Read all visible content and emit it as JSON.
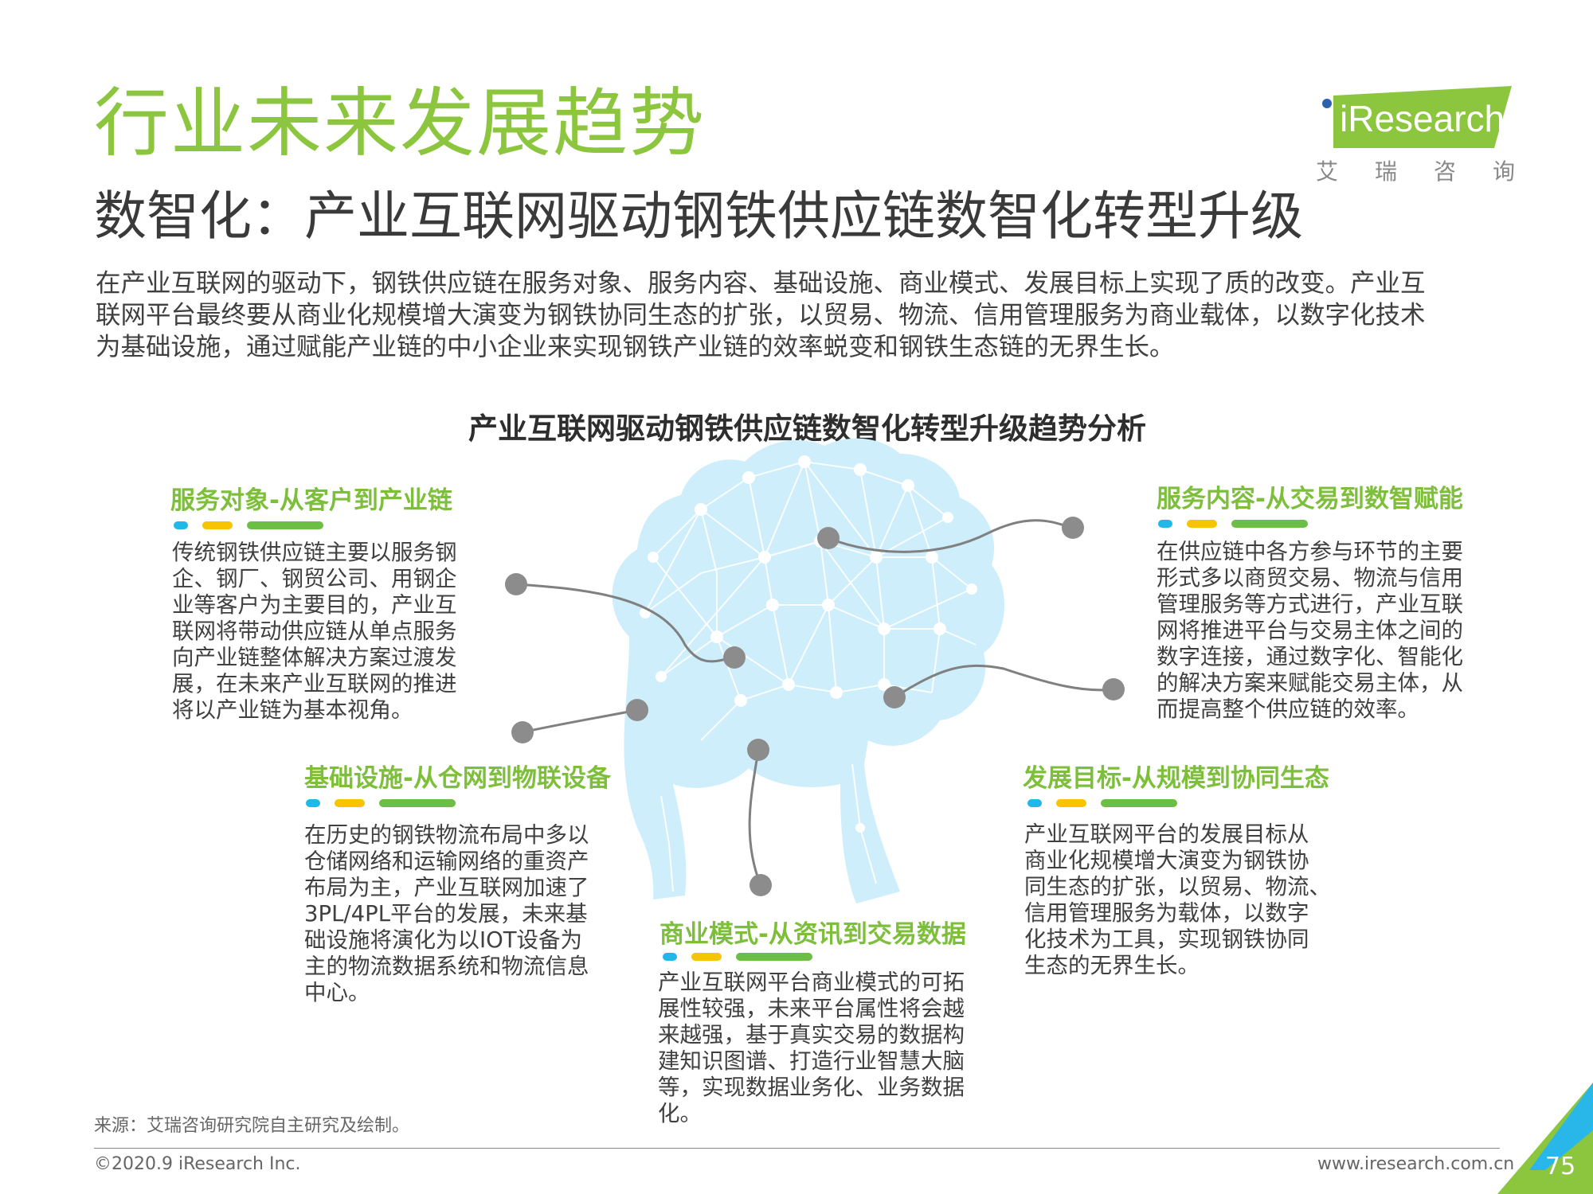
{
  "header": {
    "title": "行业未来发展趋势",
    "subtitle": "数智化：产业互联网驱动钢铁供应链数智化转型升级",
    "intro_lines": [
      "在产业互联网的驱动下，钢铁供应链在服务对象、服务内容、基础设施、商业模式、发展目标上实现了质的改变。产业互",
      "联网平台最终要从商业化规模增大演变为钢铁协同生态的扩张，以贸易、物流、信用管理服务为商业载体，以数字化技术",
      "为基础设施，通过赋能产业链的中小企业来实现钢铁产业链的效率蜕变和钢铁生态链的无界生长。"
    ]
  },
  "logo": {
    "brand": "iResearch",
    "cn": [
      "艾",
      "瑞",
      "咨",
      "询"
    ],
    "colors": {
      "green": "#8cc63f",
      "blue": "#2a62b0"
    }
  },
  "chart": {
    "title": "产业互联网驱动钢铁供应链数智化转型升级趋势分析"
  },
  "sections": {
    "service_object": {
      "heading": "服务对象-从客户到产业链",
      "lines": [
        "传统钢铁供应链主要以服务钢",
        "企、钢厂、钢贸公司、用钢企",
        "业等客户为主要目的，产业互",
        "联网将带动供应链从单点服务",
        "向产业链整体解决方案过渡发",
        "展，在未来产业互联网的推进",
        "将以产业链为基本视角。"
      ]
    },
    "service_content": {
      "heading": "服务内容-从交易到数智赋能",
      "lines": [
        "在供应链中各方参与环节的主要",
        "形式多以商贸交易、物流与信用",
        "管理服务等方式进行，产业互联",
        "网将推进平台与交易主体之间的",
        "数字连接，通过数字化、智能化",
        "的解决方案来赋能交易主体，从",
        "而提高整个供应链的效率。"
      ]
    },
    "infrastructure": {
      "heading": "基础设施-从仓网到物联设备",
      "lines": [
        "在历史的钢铁物流布局中多以",
        "仓储网络和运输网络的重资产",
        "布局为主，产业互联网加速了",
        "3PL/4PL平台的发展，未来基",
        "础设施将演化为以IOT设备为",
        "主的物流数据系统和物流信息",
        "中心。"
      ]
    },
    "development_goal": {
      "heading": "发展目标-从规模到协同生态",
      "lines": [
        "产业互联网平台的发展目标从",
        "商业化规模增大演变为钢铁协",
        "同生态的扩张，以贸易、物流、",
        "信用管理服务为载体，以数字",
        "化技术为工具，实现钢铁协同",
        "生态的无界生长。"
      ]
    },
    "business_model": {
      "heading": "商业模式-从资讯到交易数据",
      "lines": [
        "产业互联网平台商业模式的可拓",
        "展性较强，未来平台属性将会越",
        "来越强，基于真实交易的数据构",
        "建知识图谱、打造行业智慧大脑",
        "等，实现数据业务化、业务数据",
        "化。"
      ]
    }
  },
  "colors": {
    "title_green": "#8cc63f",
    "heading_green": "#7dbf3a",
    "dot_cyan": "#1fb8e8",
    "dot_yellow": "#f6c400",
    "dot_green": "#6cbe45",
    "brain_blue": "#cdeefa"
  },
  "footer": {
    "source": "来源：艾瑞咨询研究院自主研究及绘制。",
    "copyright": "©2020.9 iResearch Inc.",
    "website": "www.iresearch.com.cn",
    "page_number": "75"
  }
}
